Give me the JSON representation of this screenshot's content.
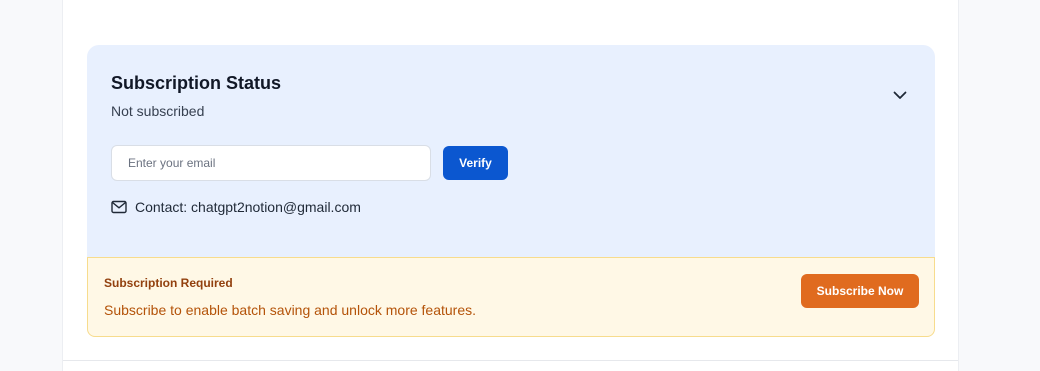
{
  "subscription": {
    "title": "Subscription Status",
    "status": "Not subscribed",
    "collapse_icon": "chevron-down-icon",
    "email": {
      "placeholder": "Enter your email",
      "value": ""
    },
    "verify_label": "Verify",
    "contact": {
      "icon": "mail-icon",
      "text": "Contact: chatgpt2notion@gmail.com"
    }
  },
  "alert": {
    "title": "Subscription Required",
    "message": "Subscribe to enable batch saving and unlock more features.",
    "subscribe_label": "Subscribe Now"
  },
  "colors": {
    "card_bg": "#e8f0fe",
    "primary": "#0b57d0",
    "alert_bg": "#fff8e6",
    "alert_border": "#f7dc8d",
    "subscribe": "#e06b1f"
  }
}
